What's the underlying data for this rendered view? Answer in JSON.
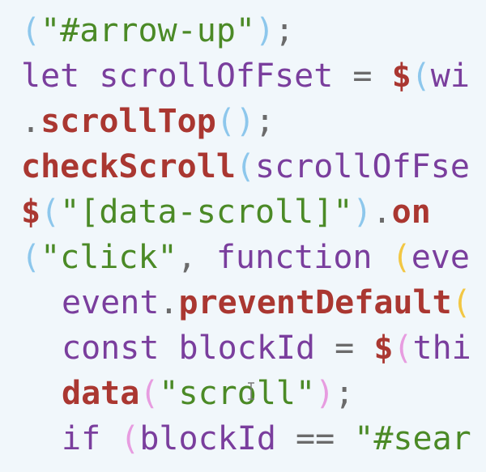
{
  "code": {
    "lines": [
      {
        "tokens": [
          {
            "text": "(",
            "kind": "paren"
          },
          {
            "text": "\"#arrow-up\"",
            "kind": "str"
          },
          {
            "text": ")",
            "kind": "paren"
          },
          {
            "text": ";",
            "kind": "punct"
          }
        ]
      },
      {
        "tokens": [
          {
            "text": "let scrollOfFset ",
            "kind": "plain"
          },
          {
            "text": "= ",
            "kind": "punct"
          },
          {
            "text": "$",
            "kind": "fn"
          },
          {
            "text": "(",
            "kind": "paren"
          },
          {
            "text": "wi",
            "kind": "plain"
          }
        ]
      },
      {
        "tokens": [
          {
            "text": ".",
            "kind": "punct"
          },
          {
            "text": "scrollTop",
            "kind": "fn"
          },
          {
            "text": "()",
            "kind": "paren"
          },
          {
            "text": ";",
            "kind": "punct"
          }
        ]
      },
      {
        "tokens": [
          {
            "text": "checkScroll",
            "kind": "fn"
          },
          {
            "text": "(",
            "kind": "paren"
          },
          {
            "text": "scrollOfFse",
            "kind": "plain"
          }
        ]
      },
      {
        "tokens": [
          {
            "text": "$",
            "kind": "fn"
          },
          {
            "text": "(",
            "kind": "paren"
          },
          {
            "text": "\"[data-scroll]\"",
            "kind": "str"
          },
          {
            "text": ")",
            "kind": "paren"
          },
          {
            "text": ".",
            "kind": "punct"
          },
          {
            "text": "on",
            "kind": "fn"
          }
        ]
      },
      {
        "tokens": [
          {
            "text": "(",
            "kind": "paren"
          },
          {
            "text": "\"click\"",
            "kind": "str"
          },
          {
            "text": ", ",
            "kind": "punct"
          },
          {
            "text": "function ",
            "kind": "plain"
          },
          {
            "text": "(",
            "kind": "paren2"
          },
          {
            "text": "eve",
            "kind": "plain"
          }
        ]
      },
      {
        "indent": true,
        "tokens": [
          {
            "text": "event",
            "kind": "plain"
          },
          {
            "text": ".",
            "kind": "punct"
          },
          {
            "text": "preventDefault",
            "kind": "fn"
          },
          {
            "text": "(",
            "kind": "paren2"
          }
        ]
      },
      {
        "indent": true,
        "tokens": [
          {
            "text": "const blockId ",
            "kind": "plain"
          },
          {
            "text": "= ",
            "kind": "punct"
          },
          {
            "text": "$",
            "kind": "fn"
          },
          {
            "text": "(",
            "kind": "paren3"
          },
          {
            "text": "thi",
            "kind": "plain"
          }
        ]
      },
      {
        "indent": true,
        "tokens": [
          {
            "text": "data",
            "kind": "fn"
          },
          {
            "text": "(",
            "kind": "paren3"
          },
          {
            "text": "\"scroll\"",
            "kind": "str"
          },
          {
            "text": ")",
            "kind": "paren3"
          },
          {
            "text": ";",
            "kind": "punct"
          }
        ]
      },
      {
        "indent": true,
        "tokens": [
          {
            "text": "if ",
            "kind": "plain"
          },
          {
            "text": "(",
            "kind": "paren3"
          },
          {
            "text": "blockId ",
            "kind": "plain"
          },
          {
            "text": "== ",
            "kind": "punct"
          },
          {
            "text": "\"#sear",
            "kind": "str"
          }
        ]
      }
    ]
  }
}
